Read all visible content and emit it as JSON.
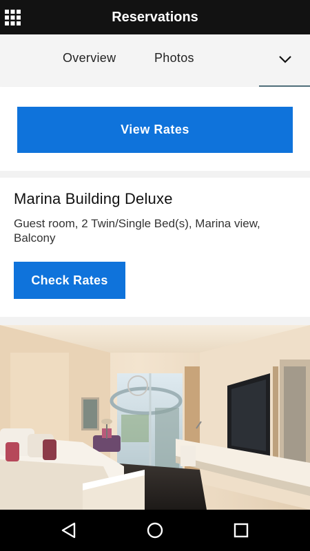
{
  "appbar": {
    "title": "Reservations",
    "menu_icon": "grid-menu-icon"
  },
  "tabs": {
    "items": [
      {
        "label": "Overview"
      },
      {
        "label": "Photos"
      }
    ],
    "more_icon": "chevron-down-icon"
  },
  "rates": {
    "button_label": "View Rates"
  },
  "room": {
    "title": "Marina Building Deluxe",
    "description": "Guest room, 2 Twin/Single Bed(s), Marina view, Balcony",
    "button_label": "Check Rates"
  },
  "photo": {
    "subject": "hotel-room-photo"
  },
  "navbar": {
    "icons": [
      "back-icon",
      "home-icon",
      "recent-apps-icon"
    ]
  },
  "colors": {
    "appbar": "#121212",
    "accent_blue": "#0f73db",
    "tab_bg": "#f4f4f4",
    "tab_indicator": "#4f6e7a"
  }
}
